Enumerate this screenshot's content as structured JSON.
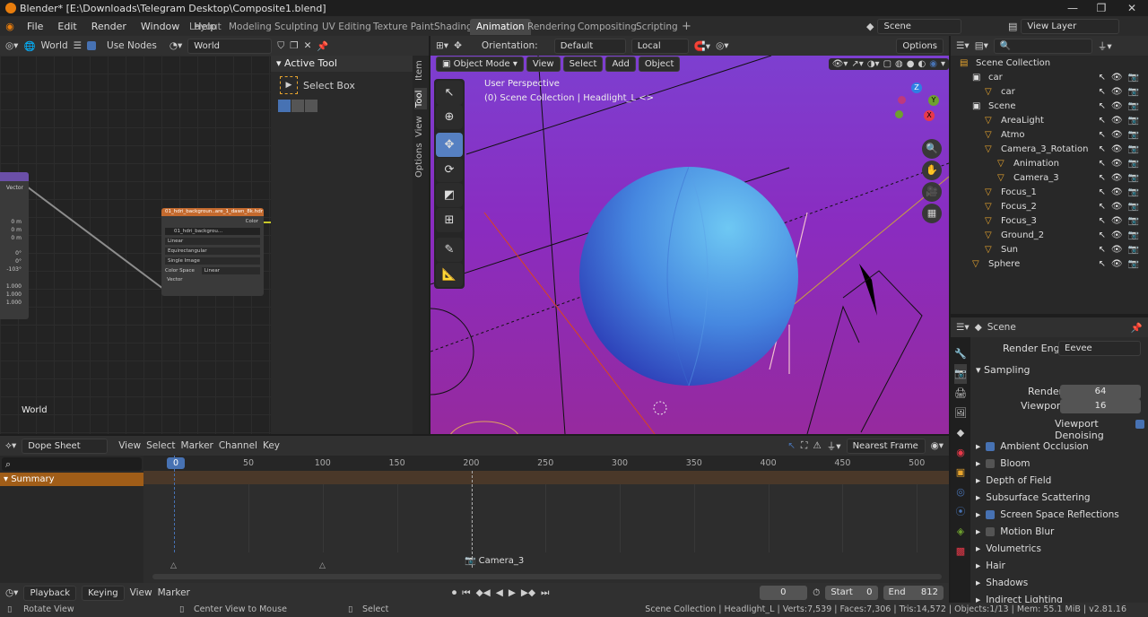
{
  "window": {
    "title": "Blender* [E:\\Downloads\\Telegram Desktop\\Composite1.blend]",
    "minimize": "—",
    "maximize": "❐",
    "close": "✕"
  },
  "menu": [
    "File",
    "Edit",
    "Render",
    "Window",
    "Help"
  ],
  "workspaces": [
    "Layout",
    "Modeling",
    "Sculpting",
    "UV Editing",
    "Texture Paint",
    "Shading",
    "Animation",
    "Rendering",
    "Compositing",
    "Scripting"
  ],
  "workspace_add": "+",
  "scene_selector": "Scene",
  "view_layer": "View Layer",
  "node_editor": {
    "world_type": "World",
    "use_nodes": "Use Nodes",
    "world_name": "World",
    "world_label": "World",
    "node_left": {
      "socket": "Vector",
      "rows": [
        "0 m",
        "0 m",
        "0 m",
        "0°",
        "0°",
        "-103°",
        "1.000",
        "1.000",
        "1.000"
      ]
    },
    "env_node": {
      "title": "01_hdri_backgroun..are_1_dawn_8k.hdr",
      "out": "Color",
      "img": "01_hdri_backgrou...",
      "interp": "Linear",
      "proj": "Equirectangular",
      "source": "Single Image",
      "cs_label": "Color Space",
      "cs_val": "Linear",
      "vector": "Vector"
    }
  },
  "tool_panel": {
    "header": "Active Tool",
    "tool": "Select Box",
    "tabs": [
      "Item",
      "Tool",
      "View",
      "Options"
    ]
  },
  "viewport": {
    "orientation_label": "Orientation:",
    "orientation": "Default",
    "transform": "Local",
    "options": "Options",
    "mode": "Object Mode",
    "menus": [
      "View",
      "Select",
      "Add",
      "Object"
    ],
    "perspective": "User Perspective",
    "info": "(0) Scene Collection | Headlight_L <>",
    "axes": {
      "z": "Z",
      "y": "Y",
      "x": "X"
    }
  },
  "outliner": {
    "rows": [
      {
        "name": "Scene Collection",
        "depth": 0
      },
      {
        "name": "car",
        "depth": 1
      },
      {
        "name": "car",
        "depth": 2
      },
      {
        "name": "Scene",
        "depth": 1
      },
      {
        "name": "AreaLight",
        "depth": 2
      },
      {
        "name": "Atmo",
        "depth": 2
      },
      {
        "name": "Camera_3_Rotation",
        "depth": 2
      },
      {
        "name": "Animation",
        "depth": 3
      },
      {
        "name": "Camera_3",
        "depth": 3
      },
      {
        "name": "Focus_1",
        "depth": 2
      },
      {
        "name": "Focus_2",
        "depth": 2
      },
      {
        "name": "Focus_3",
        "depth": 2
      },
      {
        "name": "Ground_2",
        "depth": 2
      },
      {
        "name": "Sun",
        "depth": 2
      },
      {
        "name": "Sphere",
        "depth": 1
      }
    ]
  },
  "properties": {
    "title": "Scene",
    "render_engine_label": "Render Engine",
    "render_engine": "Eevee",
    "sampling": "Sampling",
    "render_label": "Render",
    "render_val": "64",
    "viewport_label": "Viewport",
    "viewport_val": "16",
    "denoise": "Viewport Denoising",
    "sections": [
      {
        "label": "Ambient Occlusion",
        "cb": true
      },
      {
        "label": "Bloom",
        "cb": false
      },
      {
        "label": "Depth of Field"
      },
      {
        "label": "Subsurface Scattering"
      },
      {
        "label": "Screen Space Reflections",
        "cb": true
      },
      {
        "label": "Motion Blur",
        "cb": false
      },
      {
        "label": "Volumetrics"
      },
      {
        "label": "Hair"
      },
      {
        "label": "Shadows"
      },
      {
        "label": "Indirect Lighting"
      }
    ]
  },
  "dopesheet": {
    "mode": "Dope Sheet",
    "menus": [
      "View",
      "Select",
      "Marker",
      "Channel",
      "Key"
    ],
    "snap": "Nearest Frame",
    "summary": "Summary",
    "current_frame_marker": "0",
    "ticks": [
      "50",
      "100",
      "150",
      "200",
      "250",
      "300",
      "350",
      "400",
      "450",
      "500"
    ],
    "camera_marker": "Camera_3"
  },
  "timeline": {
    "playback": "Playback",
    "keying": "Keying",
    "view": "View",
    "marker": "Marker",
    "frame": "0",
    "start_label": "Start",
    "start": "0",
    "end_label": "End",
    "end": "812"
  },
  "statusbar": {
    "left": "Rotate View",
    "mid": "Center View to Mouse",
    "select": "Select",
    "right": "Scene Collection | Headlight_L | Verts:7,539 | Faces:7,306 | Tris:14,572 | Objects:1/13 | Mem: 55.1 MiB | v2.81.16"
  },
  "colors": {
    "accent": "#4772b3",
    "blender_orange": "#e87d0d",
    "viewport_top": "#7d3fd0",
    "sphere": "#4a8ee6"
  }
}
